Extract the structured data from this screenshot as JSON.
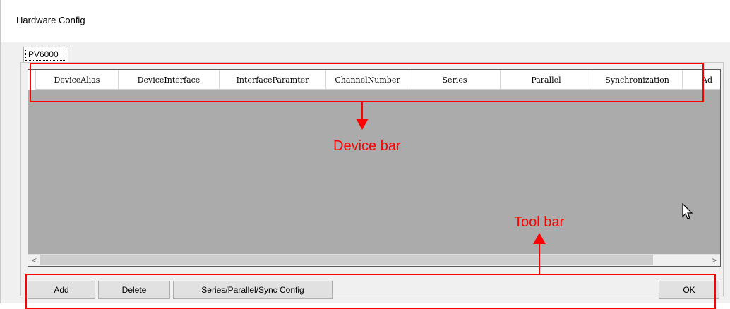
{
  "window": {
    "title": "Hardware Config"
  },
  "tab": {
    "label": "PV6000"
  },
  "grid": {
    "columns": [
      "DeviceAlias",
      "DeviceInterface",
      "InterfaceParamter",
      "ChannelNumber",
      "Series",
      "Parallel",
      "Synchronization",
      "Ad"
    ]
  },
  "scrollbar": {
    "left_arrow": "<",
    "right_arrow": ">"
  },
  "toolbar": {
    "add_label": "Add",
    "delete_label": "Delete",
    "config_label": "Series/Parallel/Sync Config",
    "ok_label": "OK"
  },
  "annotations": {
    "device_bar_label": "Device bar",
    "tool_bar_label": "Tool bar",
    "color": "#ff0000"
  }
}
